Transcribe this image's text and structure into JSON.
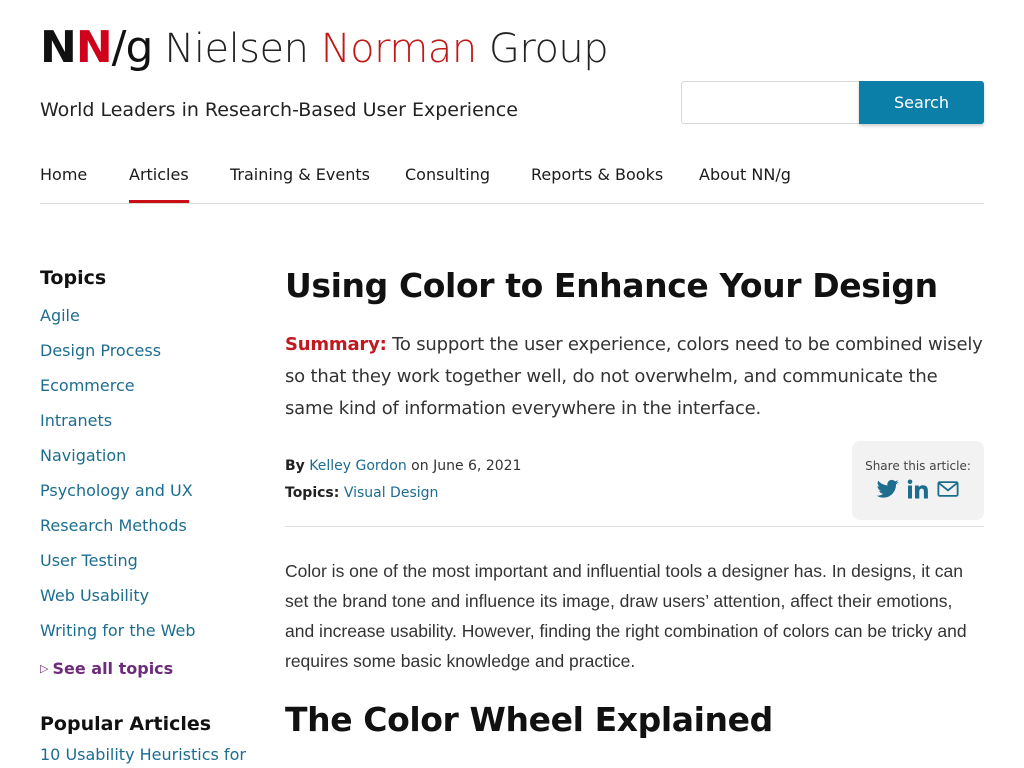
{
  "brand": {
    "mark_n1": "N",
    "mark_n2": "N",
    "mark_slash": "/",
    "mark_g": "g",
    "name_part1": "Nielsen ",
    "name_part2": "Norman",
    "name_part3": " Group",
    "tagline": "World Leaders in Research-Based User Experience",
    "red": "#c80f16"
  },
  "search": {
    "placeholder": "",
    "value": "",
    "button_label": "Search",
    "button_color": "#0b7fa8"
  },
  "nav": {
    "items": [
      {
        "label": "Home"
      },
      {
        "label": "Articles",
        "active": true
      },
      {
        "label": "Training & Events"
      },
      {
        "label": "Consulting"
      },
      {
        "label": "Reports & Books"
      },
      {
        "label": "About NN/g"
      }
    ]
  },
  "sidebar": {
    "topics_heading": "Topics",
    "topics": [
      "Agile",
      "Design Process",
      "Ecommerce",
      "Intranets",
      "Navigation",
      "Psychology and UX",
      "Research Methods",
      "User Testing",
      "Web Usability",
      "Writing for the Web"
    ],
    "see_all": "See all topics",
    "popular_heading": "Popular Articles",
    "popular": [
      "10 Usability Heuristics for"
    ]
  },
  "article": {
    "title": "Using Color to Enhance Your Design",
    "summary_label": "Summary:",
    "summary_text": " To support the user experience, colors need to be combined wisely so that they work together well, do not overwhelm, and communicate the same kind of information everywhere in the interface.",
    "by_label": "By",
    "author": "Kelley Gordon",
    "date_text": " on June 6, 2021",
    "topics_label": "Topics:",
    "topic": "Visual Design",
    "share_label": "Share this article:",
    "body": "Color is one of the most important and influential tools a designer has. In designs, it can set the brand tone and influence its image, draw users’ attention, affect their emotions, and increase usability. However, finding the right combination of colors can be tricky and requires some basic knowledge and practice.",
    "section_heading": "The Color Wheel Explained"
  },
  "icons": {
    "share": [
      "twitter-icon",
      "linkedin-icon",
      "email-icon"
    ],
    "link_color": "#1d6d8f",
    "share_icon_color": "#1d6d8f"
  }
}
